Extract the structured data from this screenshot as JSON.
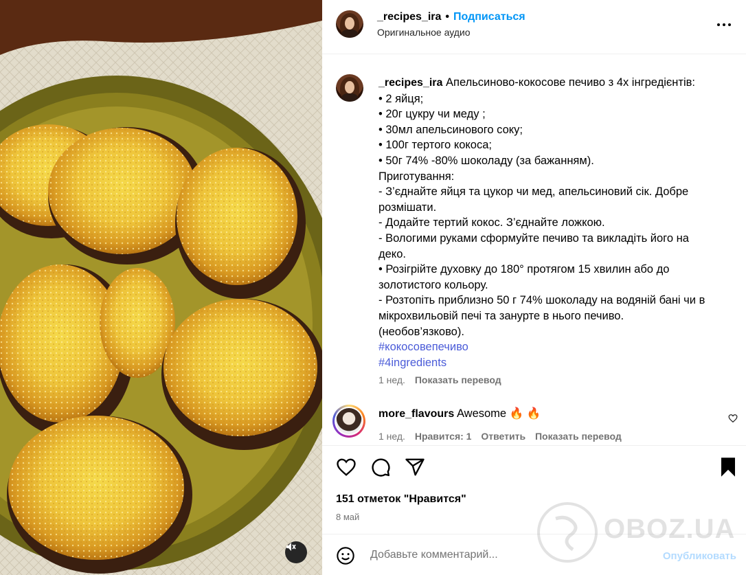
{
  "post": {
    "image_alt": "Orange-coconut cookies on a plate",
    "author": {
      "username": "_recipes_ira",
      "follow_label": "Подписаться",
      "audio_label": "Оригинальное аудио"
    },
    "caption": {
      "username": "_recipes_ira",
      "lines": [
        "Апельсиново-кокосове печиво з 4х інгредієнтів:",
        "• 2 яйця;",
        "• 20г цукру чи меду ;",
        "• 30мл апельсинового соку;",
        "• 100г тертого кокоса;",
        "• 50г 74% -80% шоколаду (за бажанням).",
        "Приготування:",
        "- З’єднайте яйця та цукор чи мед, апельсиновий сік. Добре",
        "розмішати.",
        "- Додайте тертий кокос. З’єднайте ложкою.",
        "- Вологими руками сформуйте печиво та викладіть його на",
        "деко.",
        "• Розігрійте духовку до 180° протягом 15 хвилин або до",
        "золотистого кольору.",
        "- Розтопіть приблизно 50 г 74% шоколаду на водяній бані чи в",
        "мікрохвильовій печі та занурте в нього печиво.",
        "(необов’язково)."
      ],
      "hashtags": [
        "#кокосовепечиво",
        "#4ingredients"
      ],
      "time": "1 нед.",
      "translate_label": "Показать перевод"
    },
    "comments": [
      {
        "username": "more_flavours",
        "text": "Awesome 🔥 🔥",
        "time": "1 нед.",
        "likes_label": "Нравится: 1",
        "reply_label": "Ответить",
        "translate_label": "Показать перевод"
      }
    ],
    "likes_text": "151 отметок \"Нравится\"",
    "date": "8 май",
    "add_comment_placeholder": "Добавьте комментарий...",
    "publish_label": "Опубликовать",
    "watermark": "OBOZ.UA"
  }
}
